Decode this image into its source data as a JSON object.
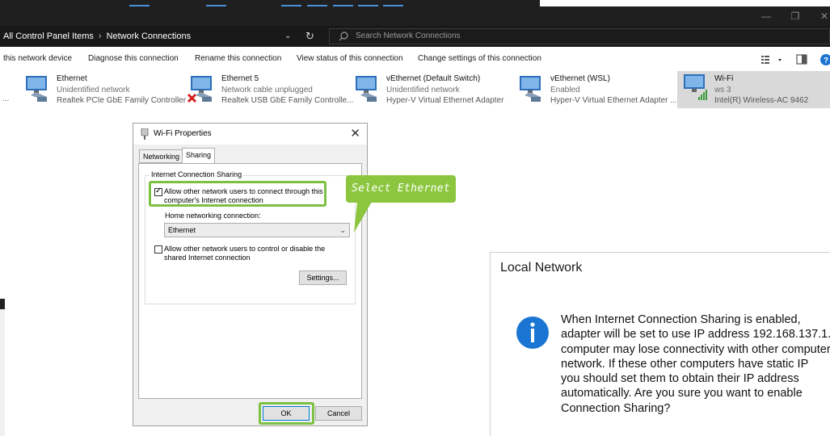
{
  "explorer": {
    "breadcrumb": [
      "All Control Panel Items",
      "Network Connections"
    ],
    "search_placeholder": "Search Network Connections",
    "window_controls": {
      "minimize": "—",
      "maximize": "❐",
      "close": "✕"
    },
    "command_bar": [
      "this network device",
      "Diagnose this connection",
      "Rename this connection",
      "View status of this connection",
      "Change settings of this connection"
    ],
    "adapters": [
      {
        "name": "Ethernet",
        "status": "Unidentified network",
        "desc": "Realtek PCIe GbE Family Controller",
        "state": "connected"
      },
      {
        "name": "Ethernet 5",
        "status": "Network cable unplugged",
        "desc": "Realtek USB GbE Family Controlle...",
        "state": "unplugged"
      },
      {
        "name": "vEthernet (Default Switch)",
        "status": "Unidentified network",
        "desc": "Hyper-V Virtual Ethernet Adapter",
        "state": "connected"
      },
      {
        "name": "vEthernet (WSL)",
        "status": "Enabled",
        "desc": "Hyper-V Virtual Ethernet Adapter ...",
        "state": "connected"
      },
      {
        "name": "Wi-Fi",
        "status": "ws 3",
        "desc": "Intel(R) Wireless-AC 9462",
        "state": "wifi"
      }
    ],
    "adapter_left_fragment": "..."
  },
  "wifi_props": {
    "title": "Wi-Fi Properties",
    "close": "✕",
    "tabs": [
      "Networking",
      "Sharing"
    ],
    "group_label": "Internet Connection Sharing",
    "allow_connect_line1": "Allow other network users to connect through this",
    "allow_connect_line2": "computer's Internet connection",
    "allow_connect_checked": true,
    "home_label": "Home networking connection:",
    "home_value": "Ethernet",
    "allow_control_line1": "Allow other network users to control or disable the",
    "allow_control_line2": "shared Internet connection",
    "allow_control_checked": false,
    "settings_label": "Settings...",
    "ok_label": "OK",
    "cancel_label": "Cancel"
  },
  "callout": {
    "text": "Select Ethernet",
    "color": "#8cc63f"
  },
  "local_network": {
    "title": "Local Network",
    "lines": [
      "When Internet Connection Sharing is enabled,",
      "adapter will be set to use IP address 192.168.137.1.",
      "computer may lose connectivity with other computers",
      "network. If these other computers have static IP",
      "you should set them to obtain their IP address",
      "automatically.  Are you sure you want to enable",
      "Connection Sharing?"
    ]
  },
  "colors": {
    "accent": "#0078d7",
    "highlight": "#7dc142",
    "dark_bar": "#1f1f1f"
  }
}
